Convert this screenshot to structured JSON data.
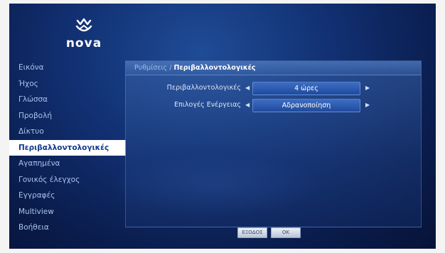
{
  "brand": {
    "logo_text": "nova"
  },
  "sidebar": {
    "items": [
      {
        "label": "Εικόνα"
      },
      {
        "label": "Ήχος"
      },
      {
        "label": "Γλώσσα"
      },
      {
        "label": "Προβολή"
      },
      {
        "label": "Δίκτυο"
      },
      {
        "label": "Περιβαλλοντολογικές",
        "active": true
      },
      {
        "label": "Αγαπημένα"
      },
      {
        "label": "Γονικός έλεγχος"
      },
      {
        "label": "Εγγραφές"
      },
      {
        "label": "Multiview"
      },
      {
        "label": "Βοήθεια"
      }
    ]
  },
  "panel": {
    "breadcrumb_parent": "Ρυθμίσεις",
    "breadcrumb_separator": " / ",
    "breadcrumb_current": "Περιβαλλοντολογικές",
    "settings": [
      {
        "label": "Περιβαλλοντολογικές",
        "value": "4 ώρες"
      },
      {
        "label": "Επιλογές Ενέργειας",
        "value": "Αδρανοποίηση"
      }
    ]
  },
  "footer": {
    "exit_label": "ΕΞΟΔΟΣ",
    "ok_label": "OK"
  },
  "icons": {
    "logo": "nova-crown-logo",
    "left_arrow": "arrow-left-icon",
    "right_arrow": "arrow-right-icon"
  },
  "colors": {
    "background": "#123174",
    "active_item_bg": "#ffffff",
    "active_item_text": "#123b8c",
    "value_box": "#2c5cb3"
  }
}
